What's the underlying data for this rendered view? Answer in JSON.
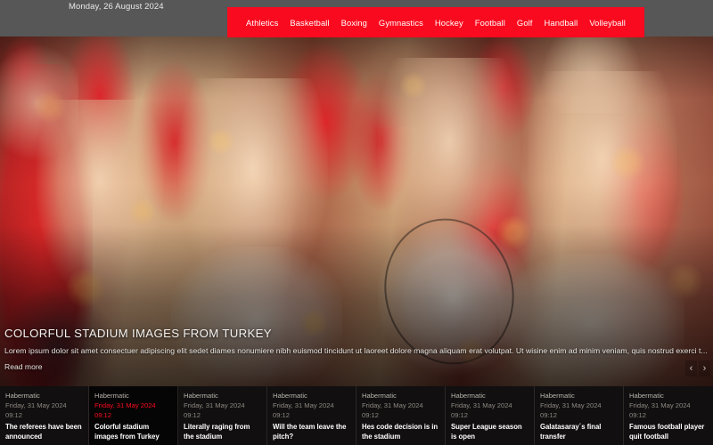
{
  "topbar": {
    "date": "Monday, 26 August 2024"
  },
  "nav": {
    "items": [
      {
        "label": "Athletics"
      },
      {
        "label": "Basketball"
      },
      {
        "label": "Boxing"
      },
      {
        "label": "Gymnastics"
      },
      {
        "label": "Hockey"
      },
      {
        "label": "Football"
      },
      {
        "label": "Golf"
      },
      {
        "label": "Handball"
      },
      {
        "label": "Volleyball"
      }
    ]
  },
  "hero": {
    "title": "COLORFUL STADIUM IMAGES FROM TURKEY",
    "description": "Lorem ipsum dolor sit amet consectuer adipiscing elit sedet diames nonumiere nibh euismod tincidunt ut laoreet dolore magna aliquam erat volutpat. Ut wisine enim ad minim veniam, quis nostrud exerci t...",
    "read_more": "Read more",
    "prev_icon": "‹",
    "next_icon": "›"
  },
  "colors": {
    "accent": "#fa0a1e",
    "topbar_bg": "#575757",
    "strip_bg": "#050505"
  },
  "news": {
    "cards": [
      {
        "source": "Habermatic",
        "date": "Friday, 31 May 2024",
        "time": "09:12",
        "title": "The referees have been announced",
        "active": false
      },
      {
        "source": "Habermatic",
        "date": "Friday, 31 May 2024",
        "time": "09:12",
        "title": "Colorful stadium images from Turkey",
        "active": true
      },
      {
        "source": "Habermatic",
        "date": "Friday, 31 May 2024",
        "time": "09:12",
        "title": "Literally raging from the stadium",
        "active": false
      },
      {
        "source": "Habermatic",
        "date": "Friday, 31 May 2024",
        "time": "09:12",
        "title": "Will the team leave the pitch?",
        "active": false
      },
      {
        "source": "Habermatic",
        "date": "Friday, 31 May 2024",
        "time": "09:12",
        "title": "Hes code decision is in the stadium",
        "active": false
      },
      {
        "source": "Habermatic",
        "date": "Friday, 31 May 2024",
        "time": "09:12",
        "title": "Super League season is open",
        "active": false
      },
      {
        "source": "Habermatic",
        "date": "Friday, 31 May 2024",
        "time": "09:12",
        "title": "Galatasaray´s final transfer",
        "active": false
      },
      {
        "source": "Habermatic",
        "date": "Friday, 31 May 2024",
        "time": "09:12",
        "title": "Famous football player quit football",
        "active": false
      }
    ]
  }
}
